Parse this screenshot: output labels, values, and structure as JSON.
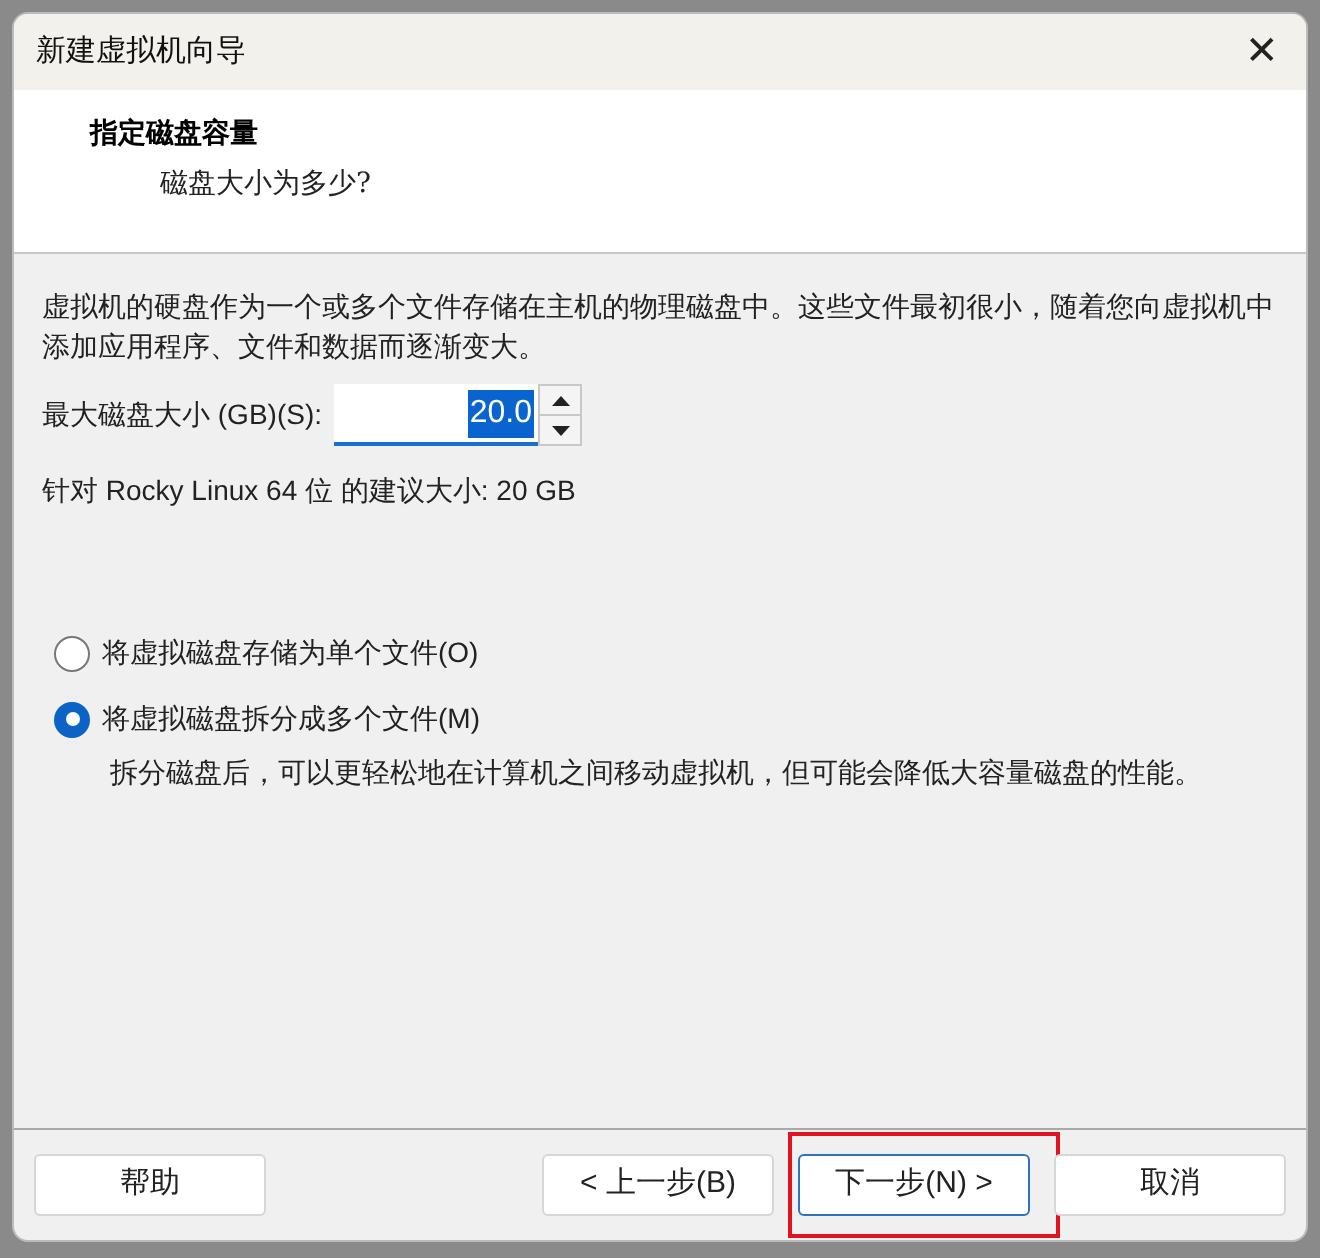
{
  "window": {
    "title": "新建虚拟机向导",
    "close": "✕"
  },
  "header": {
    "title": "指定磁盘容量",
    "subtitle": "磁盘大小为多少?"
  },
  "description": "虚拟机的硬盘作为一个或多个文件存储在主机的物理磁盘中。这些文件最初很小，随着您向虚拟机中添加应用程序、文件和数据而逐渐变大。",
  "disk_size": {
    "label": "最大磁盘大小 (GB)(S):",
    "value": "20.0"
  },
  "recommendation": "针对 Rocky Linux 64 位 的建议大小: 20 GB",
  "options": [
    {
      "label": "将虚拟磁盘存储为单个文件(O)",
      "selected": false
    },
    {
      "label": "将虚拟磁盘拆分成多个文件(M)",
      "selected": true
    }
  ],
  "split_note": "拆分磁盘后，可以更轻松地在计算机之间移动虚拟机，但可能会降低大容量磁盘的性能。",
  "buttons": [
    {
      "label": "帮助",
      "kind": "help",
      "focused": false,
      "highlighted": false
    },
    {
      "label": "< 上一步(B)",
      "kind": "back",
      "focused": false,
      "highlighted": false
    },
    {
      "label": "下一步(N) >",
      "kind": "next",
      "focused": true,
      "highlighted": true
    },
    {
      "label": "取消",
      "kind": "cancel",
      "focused": false,
      "highlighted": false
    }
  ]
}
